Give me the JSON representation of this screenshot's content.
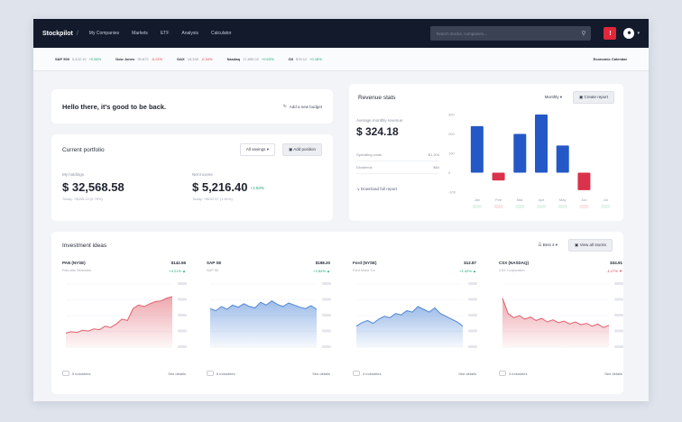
{
  "topbar": {
    "brand": "Stockpilot",
    "nav": [
      "My Companies",
      "Markets",
      "ETF",
      "Analysis",
      "Calculator"
    ],
    "search_placeholder": "Search stocks, companies...",
    "alert": "!"
  },
  "ticker": {
    "items": [
      {
        "sym": "S&P 500",
        "val": "5,432.19",
        "chg": "+0.54%",
        "dir": "up"
      },
      {
        "sym": "Dow Jones",
        "val": "39,872",
        "chg": "-0.21%",
        "dir": "dn"
      },
      {
        "sym": "DAX",
        "val": "18,330",
        "chg": "-0.34%",
        "dir": "dn"
      },
      {
        "sym": "Nasdaq",
        "val": "17,856.02",
        "chg": "+0.63%",
        "dir": "up"
      },
      {
        "sym": "Oil",
        "val": "$78.12",
        "chg": "+0.18%",
        "dir": "up"
      }
    ],
    "news": "Economic Calendar"
  },
  "greeting": {
    "text": "Hello there, it's good to be back.",
    "link": "Add a new budget"
  },
  "portfolio": {
    "title": "Current portfolio",
    "filter": "All savings",
    "action": "Add position",
    "left": {
      "label": "My holdings",
      "value": "$ 32,568.58",
      "sub": "Today: +$245.14 (0.76%)"
    },
    "right": {
      "label": "Net income",
      "value": "$ 5,216.40",
      "gain": "+1.93%",
      "sub": "Today: +$102.57 (1.81%)"
    }
  },
  "revenue": {
    "title": "Revenue stats",
    "period": "Monthly",
    "action": "Create report",
    "label": "Average monthly revenue",
    "value": "$ 324.18",
    "rows": [
      [
        "Operating costs",
        "$1,204"
      ],
      [
        "Dividends",
        "$84"
      ]
    ],
    "link": "Download full report"
  },
  "watchlist": {
    "title": "Investment ideas",
    "filter": "Best 4",
    "action": "View all stocks",
    "cards": [
      {
        "name": "PAN (NYSE)",
        "price": "$142.56",
        "sub": "Palo Alto Networks",
        "chg": "+4.21% ▲",
        "dir": "up",
        "fig": "5 industries",
        "more": "See details"
      },
      {
        "name": "SAP SE",
        "price": "$198.20",
        "sub": "SAP SE",
        "chg": "+2.84% ▲",
        "dir": "up",
        "fig": "6 industries",
        "more": "See details"
      },
      {
        "name": "Ford (NYSE)",
        "price": "$12.87",
        "sub": "Ford Motor Co.",
        "chg": "+1.42% ▲",
        "dir": "up",
        "fig": "4 industries",
        "more": "See details"
      },
      {
        "name": "CSX (NASDAQ)",
        "price": "$34.91",
        "sub": "CSX Corporation",
        "chg": "-1.27% ▼",
        "dir": "dn",
        "fig": "3 industries",
        "more": "See details"
      }
    ]
  },
  "colors": {
    "up": "#17a673",
    "down": "#d9404f",
    "bar_up": "#2458c6",
    "bar_down": "#d9324a",
    "line_red": "#e0606d",
    "line_blue": "#4f86d6"
  },
  "chart_data": [
    {
      "type": "bar",
      "categories": [
        "Jan",
        "Feb",
        "Mar",
        "Apr",
        "May",
        "Jun",
        "Jul"
      ],
      "values": [
        240,
        -40,
        200,
        300,
        140,
        -90,
        0
      ],
      "ylim": [
        -100,
        300
      ],
      "yticks": [
        "300",
        "200",
        "100",
        "0",
        "-100"
      ]
    },
    {
      "type": "area",
      "x": [
        0,
        1,
        2,
        3,
        4,
        5,
        6,
        7,
        8,
        9,
        10,
        11,
        12,
        13,
        14,
        15,
        16,
        17,
        18,
        19
      ],
      "values": [
        20,
        22,
        21,
        24,
        23,
        26,
        25,
        30,
        28,
        33,
        40,
        38,
        55,
        60,
        58,
        62,
        65,
        66,
        70,
        72
      ],
      "ylim": [
        0,
        90
      ]
    },
    {
      "type": "area",
      "x": [
        0,
        1,
        2,
        3,
        4,
        5,
        6,
        7,
        8,
        9,
        10,
        11,
        12,
        13,
        14,
        15,
        16,
        17,
        18,
        19
      ],
      "values": [
        55,
        52,
        58,
        54,
        60,
        57,
        62,
        58,
        56,
        64,
        60,
        66,
        61,
        58,
        63,
        60,
        57,
        55,
        59,
        54
      ],
      "ylim": [
        0,
        90
      ]
    },
    {
      "type": "area",
      "x": [
        0,
        1,
        2,
        3,
        4,
        5,
        6,
        7,
        8,
        9,
        10,
        11,
        12,
        13,
        14,
        15,
        16,
        17,
        18,
        19
      ],
      "values": [
        30,
        35,
        38,
        34,
        40,
        44,
        42,
        48,
        46,
        52,
        50,
        58,
        54,
        50,
        56,
        48,
        44,
        40,
        36,
        30
      ],
      "ylim": [
        0,
        90
      ]
    },
    {
      "type": "area",
      "x": [
        0,
        1,
        2,
        3,
        4,
        5,
        6,
        7,
        8,
        9,
        10,
        11,
        12,
        13,
        14,
        15,
        16,
        17,
        18,
        19
      ],
      "values": [
        70,
        48,
        42,
        45,
        40,
        43,
        38,
        41,
        36,
        39,
        35,
        37,
        33,
        36,
        32,
        34,
        30,
        33,
        28,
        31
      ],
      "ylim": [
        0,
        90
      ]
    }
  ]
}
